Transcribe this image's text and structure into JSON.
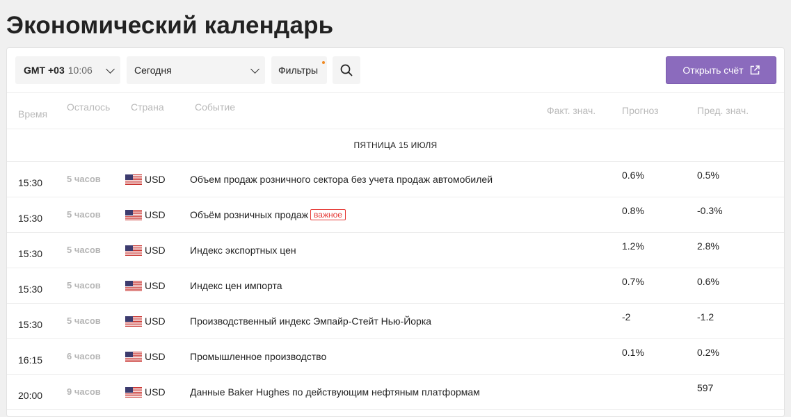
{
  "page_title": "Экономический календарь",
  "toolbar": {
    "timezone": "GMT +03",
    "clock": "10:06",
    "date_select": "Сегодня",
    "filters_label": "Фильтры",
    "open_account_label": "Открыть счёт",
    "accent": "#8b6bbd",
    "filter_dot_color": "#f08a24"
  },
  "columns": {
    "time": "Время",
    "remaining": "Осталось",
    "country": "Страна",
    "event": "Событие",
    "actual": "Факт. знач.",
    "forecast": "Прогноз",
    "previous": "Пред. знач."
  },
  "day_header": "ПЯТНИЦА 15 ИЮЛЯ",
  "events": [
    {
      "time": "15:30",
      "remaining": "5 часов",
      "currency": "USD",
      "flag": "us-flag-icon",
      "event": "Объем продаж розничного сектора без учета продаж автомобилей",
      "badge": "",
      "forecast": "0.6%",
      "previous": "0.5%"
    },
    {
      "time": "15:30",
      "remaining": "5 часов",
      "currency": "USD",
      "flag": "us-flag-icon",
      "event": "Объём розничных продаж",
      "badge": "важное",
      "forecast": "0.8%",
      "previous": "-0.3%"
    },
    {
      "time": "15:30",
      "remaining": "5 часов",
      "currency": "USD",
      "flag": "us-flag-icon",
      "event": "Индекс экспортных цен",
      "badge": "",
      "forecast": "1.2%",
      "previous": "2.8%"
    },
    {
      "time": "15:30",
      "remaining": "5 часов",
      "currency": "USD",
      "flag": "us-flag-icon",
      "event": "Индекс цен импорта",
      "badge": "",
      "forecast": "0.7%",
      "previous": "0.6%"
    },
    {
      "time": "15:30",
      "remaining": "5 часов",
      "currency": "USD",
      "flag": "us-flag-icon",
      "event": "Производственный индекс Эмпайр-Стейт Нью-Йорка",
      "badge": "",
      "forecast": "-2",
      "previous": "-1.2"
    },
    {
      "time": "16:15",
      "remaining": "6 часов",
      "currency": "USD",
      "flag": "us-flag-icon",
      "event": "Промышленное производство",
      "badge": "",
      "forecast": "0.1%",
      "previous": "0.2%"
    },
    {
      "time": "20:00",
      "remaining": "9 часов",
      "currency": "USD",
      "flag": "us-flag-icon",
      "event": "Данные Baker Hughes по действующим нефтяным платформам",
      "badge": "",
      "forecast": "",
      "previous": "597"
    }
  ]
}
